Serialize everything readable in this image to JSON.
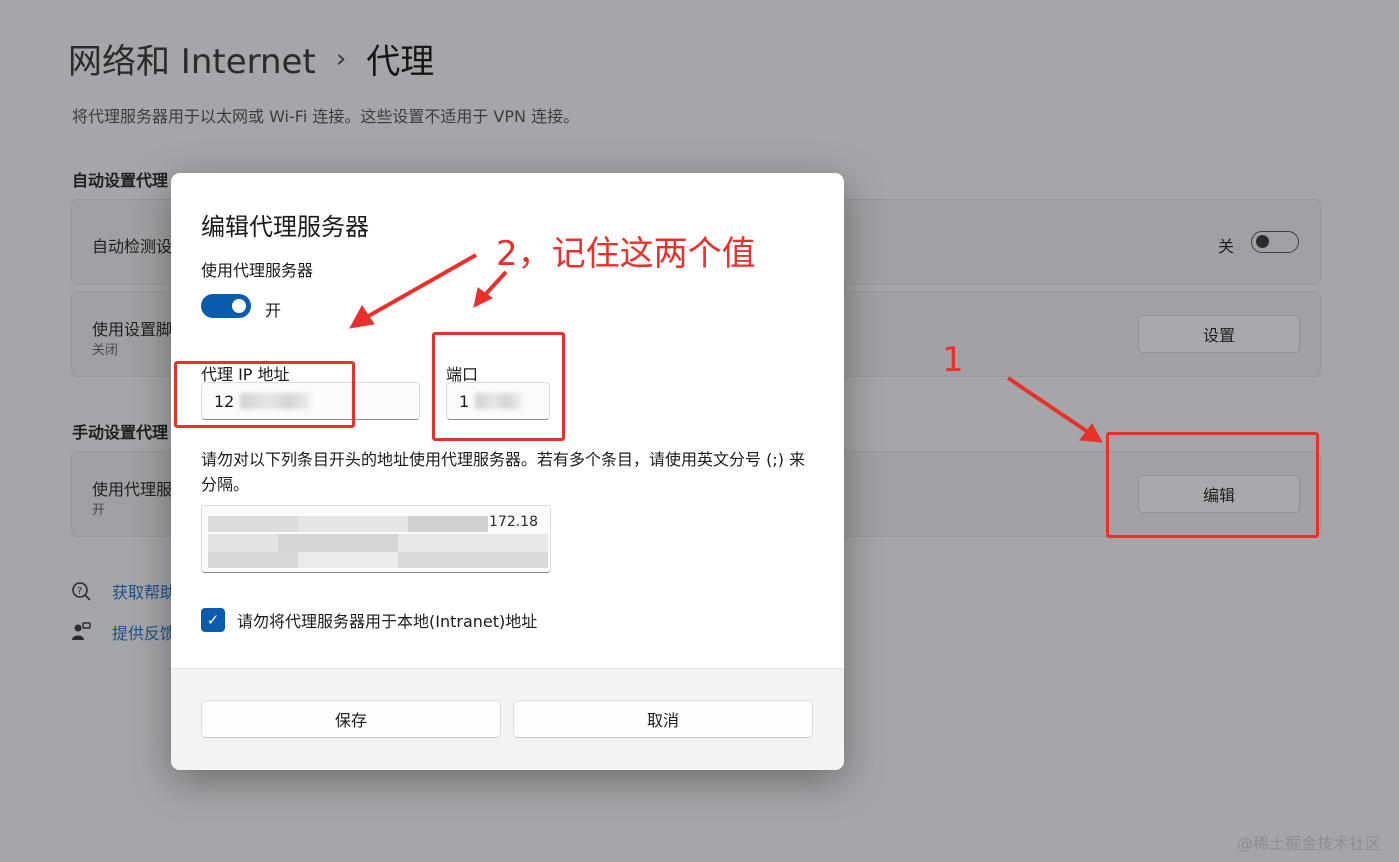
{
  "breadcrumb": {
    "parent": "网络和 Internet",
    "separator": "›",
    "current": "代理"
  },
  "description": "将代理服务器用于以太网或 Wi-Fi 连接。这些设置不适用于 VPN 连接。",
  "auto_section": {
    "title": "自动设置代理",
    "detect_label": "自动检测设置",
    "detect_state": "关",
    "script_label": "使用设置脚本",
    "script_state": "关闭",
    "script_button": "设置"
  },
  "manual_section": {
    "title": "手动设置代理",
    "proxy_label": "使用代理服务器",
    "proxy_state": "开",
    "edit_button": "编辑"
  },
  "links": {
    "help": "获取帮助",
    "feedback": "提供反馈"
  },
  "dialog": {
    "title": "编辑代理服务器",
    "use_proxy_label": "使用代理服务器",
    "toggle_state": "开",
    "ip_label": "代理 IP 地址",
    "ip_value": "12",
    "port_label": "端口",
    "port_value": "1",
    "exclusion_note": "请勿对以下列条目开头的地址使用代理服务器。若有多个条目，请使用英文分号 (;) 来分隔。",
    "exclusion_value": "172.18",
    "local_checkbox_label": "请勿将代理服务器用于本地(Intranet)地址",
    "save_button": "保存",
    "cancel_button": "取消"
  },
  "annotations": {
    "step1": "1",
    "step2": "2，记住这两个值",
    "color": "#e8312c"
  },
  "watermark": "@稀土掘金技术社区"
}
